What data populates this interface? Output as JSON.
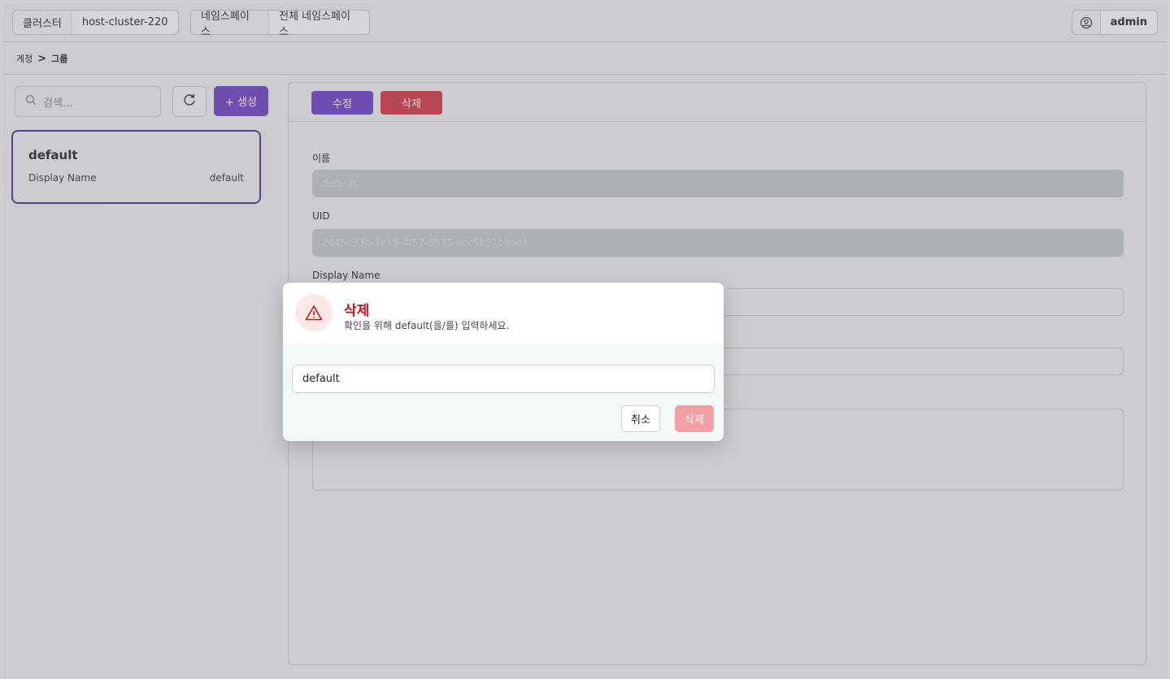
{
  "header": {
    "cluster_label": "클러스터",
    "cluster_value": "host-cluster-220",
    "namespace_label": "네임스페이스",
    "namespace_value": "전체 네임스페이스",
    "user_name": "admin"
  },
  "breadcrumb": {
    "parent": "계정",
    "separator": ">",
    "current": "그룹"
  },
  "sidebar": {
    "search_placeholder": "검색...",
    "create_label": "+ 생성",
    "cards": [
      {
        "name": "default",
        "field_label": "Display Name",
        "field_value": "default"
      }
    ]
  },
  "detail": {
    "edit_label": "수정",
    "delete_label": "삭제",
    "fields": [
      {
        "label": "이름",
        "value": "default"
      },
      {
        "label": "UID",
        "value": "2045c33b-7e19-4f57-8575-ecc5b51bbae1"
      },
      {
        "label": "Display Name",
        "value": ""
      }
    ]
  },
  "modal": {
    "title": "삭제",
    "message": "확인을 위해 default(을/를) 입력하세요.",
    "input_value": "default",
    "cancel_label": "취소",
    "confirm_label": "삭제"
  },
  "colors": {
    "primary": "#6b3fc1",
    "danger": "#d23541",
    "danger_disabled": "#f3a0a5",
    "warning_title": "#c3161f"
  },
  "icons": [
    "user-circle-icon",
    "search-icon",
    "refresh-icon",
    "warning-icon"
  ]
}
